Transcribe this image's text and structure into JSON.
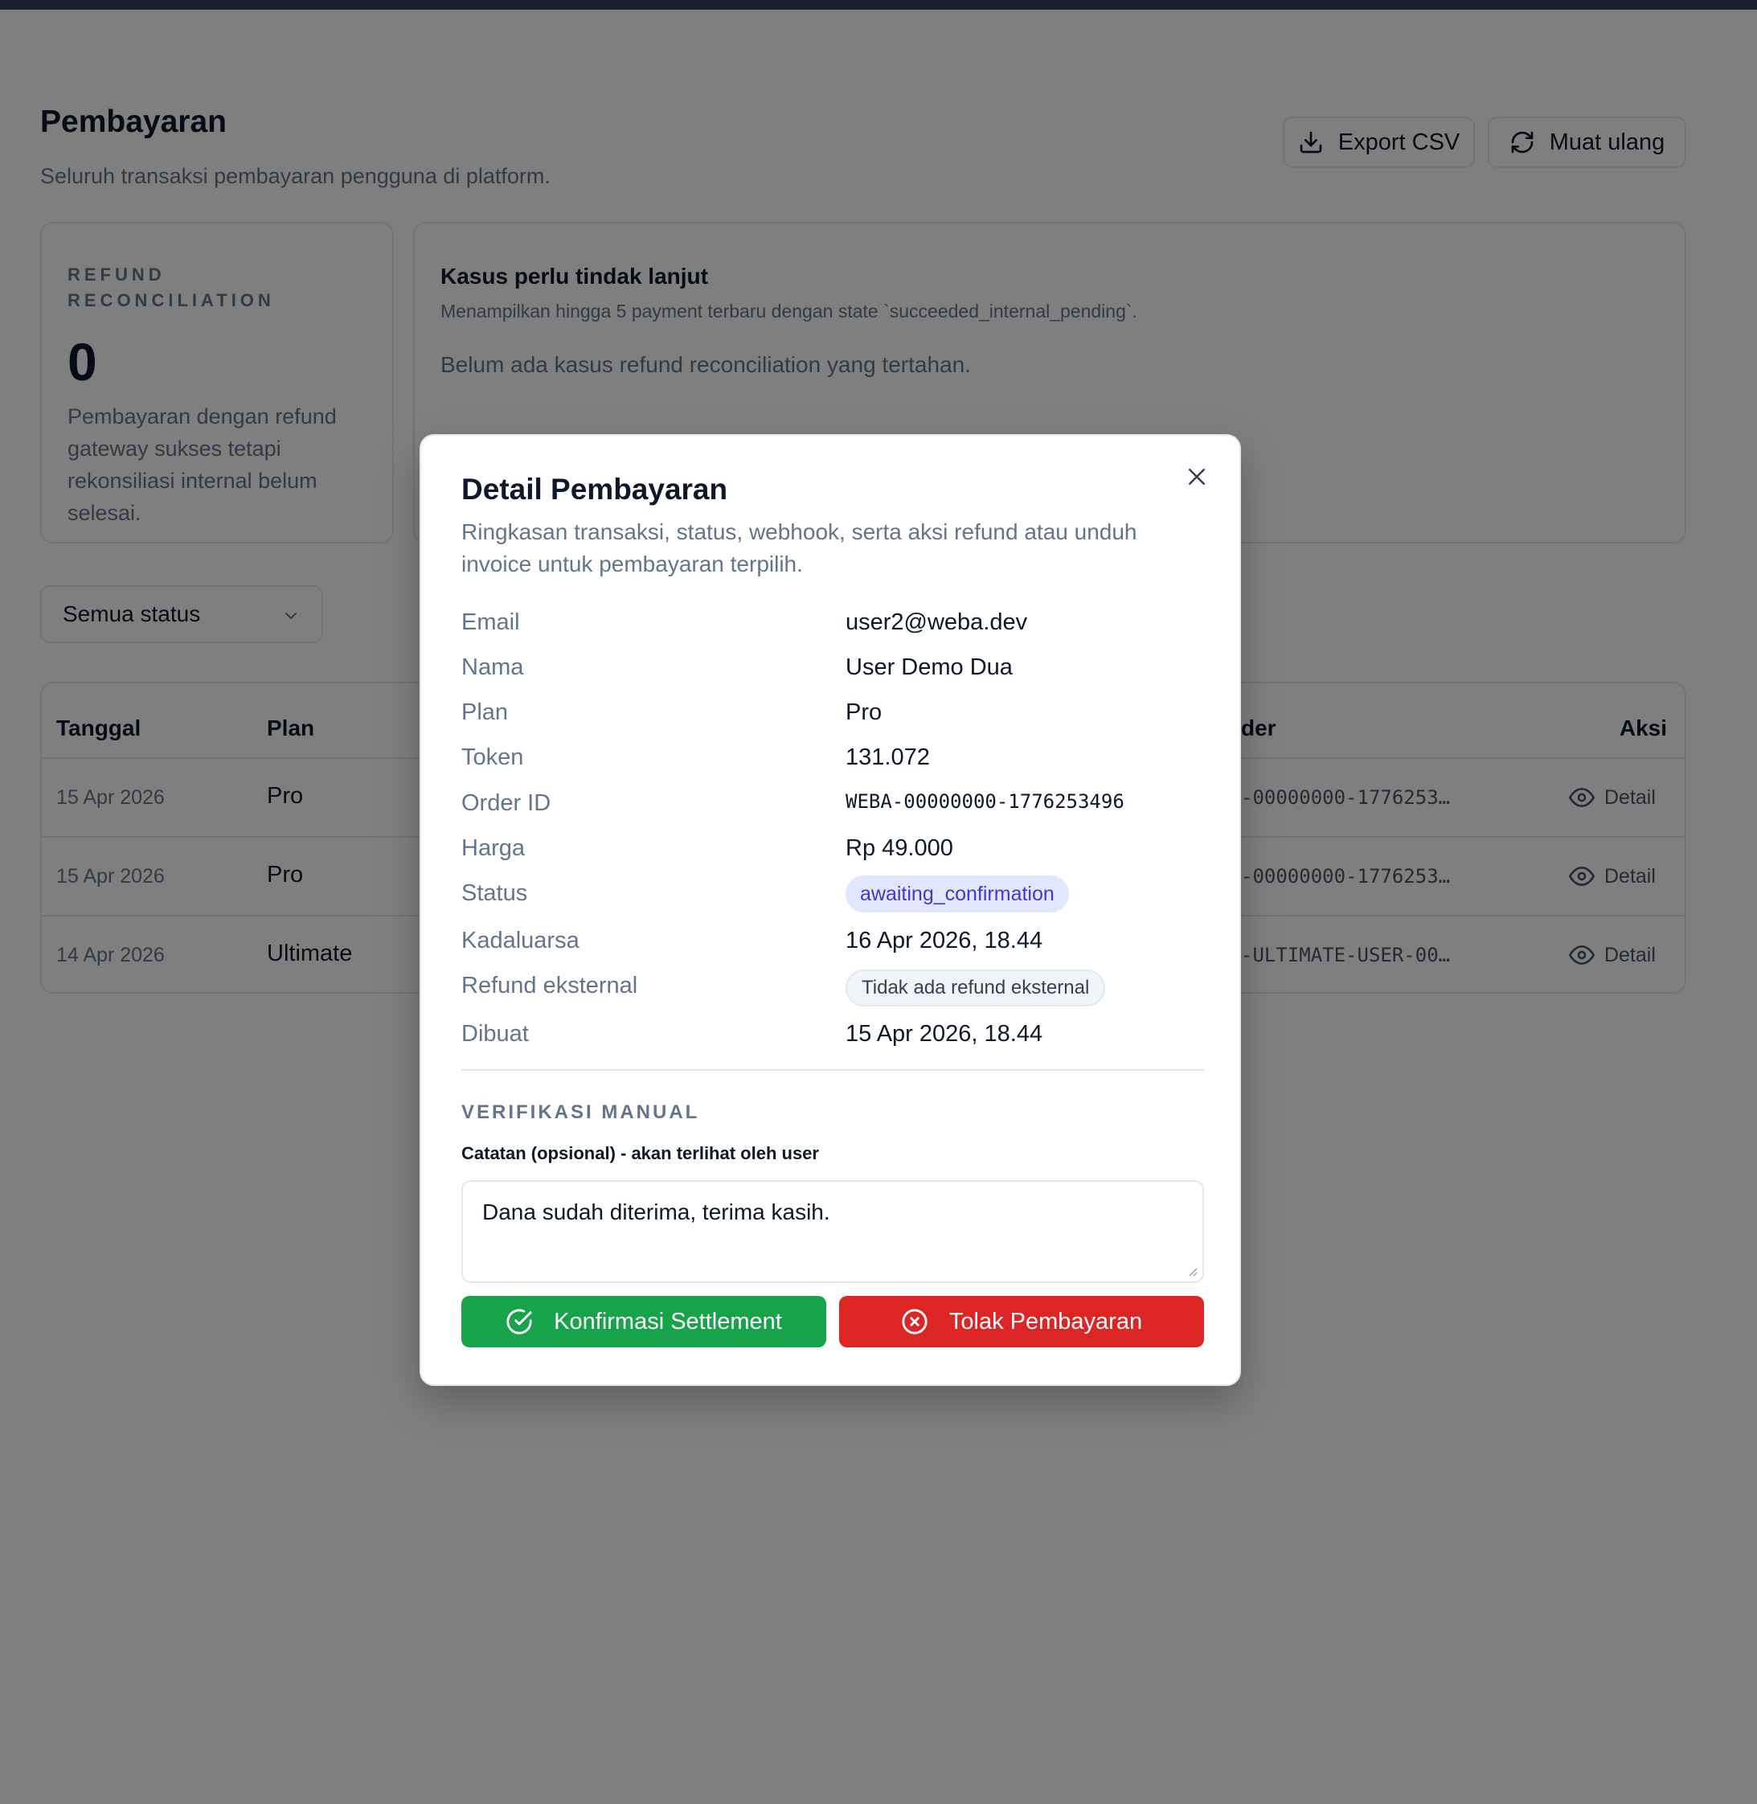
{
  "header": {
    "title": "Pembayaran",
    "subtitle": "Seluruh transaksi pembayaran pengguna di platform.",
    "export_label": "Export CSV",
    "reload_label": "Muat ulang"
  },
  "refund_card": {
    "eyebrow": "REFUND RECONCILIATION",
    "count": "0",
    "description": "Pembayaran dengan refund gateway sukses tetapi rekonsiliasi internal belum selesai."
  },
  "cases_card": {
    "title": "Kasus perlu tindak lanjut",
    "subtitle": "Menampilkan hingga 5 payment terbaru dengan state `succeeded_internal_pending`.",
    "empty": "Belum ada kasus refund reconciliation yang tertahan."
  },
  "filter": {
    "selected": "Semua status"
  },
  "table": {
    "columns": {
      "date": "Tanggal",
      "plan": "Plan",
      "order": "der",
      "action": "Aksi"
    },
    "rows": [
      {
        "date": "15 Apr 2026",
        "plan": "Pro",
        "order": "-00000000-1776253…",
        "action": "Detail"
      },
      {
        "date": "15 Apr 2026",
        "plan": "Pro",
        "order": "-00000000-1776253…",
        "action": "Detail"
      },
      {
        "date": "14 Apr 2026",
        "plan": "Ultimate",
        "order": "-ULTIMATE-USER-00…",
        "action": "Detail"
      }
    ]
  },
  "modal": {
    "title": "Detail Pembayaran",
    "subtitle": "Ringkasan transaksi, status, webhook, serta aksi refund atau unduh invoice untuk pembayaran terpilih.",
    "fields": {
      "email": {
        "label": "Email",
        "value": "user2@weba.dev"
      },
      "nama": {
        "label": "Nama",
        "value": "User Demo Dua"
      },
      "plan": {
        "label": "Plan",
        "value": "Pro"
      },
      "token": {
        "label": "Token",
        "value": "131.072"
      },
      "order_id": {
        "label": "Order ID",
        "value": "WEBA-00000000-1776253496"
      },
      "harga": {
        "label": "Harga",
        "value": "Rp 49.000"
      },
      "status": {
        "label": "Status",
        "value": "awaiting_confirmation"
      },
      "kadaluarsa": {
        "label": "Kadaluarsa",
        "value": "16 Apr 2026, 18.44"
      },
      "refund": {
        "label": "Refund eksternal",
        "value": "Tidak ada refund eksternal"
      },
      "dibuat": {
        "label": "Dibuat",
        "value": "15 Apr 2026, 18.44"
      }
    },
    "verification": {
      "section_title": "VERIFIKASI MANUAL",
      "note_label": "Catatan (opsional) - akan terlihat oleh user",
      "note_value": "Dana sudah diterima, terima kasih.",
      "confirm_label": "Konfirmasi Settlement",
      "reject_label": "Tolak Pembayaran"
    }
  },
  "icons": {
    "export": "download-icon",
    "reload": "refresh-icon",
    "select": "chevron-down-icon",
    "detail": "eye-icon",
    "close": "close-icon",
    "confirm": "check-circle-icon",
    "reject": "x-circle-icon"
  },
  "colors": {
    "topbar": "#334155",
    "confirm": "#16a34a",
    "reject": "#dc2626",
    "status_badge_bg": "#e0e7ff",
    "status_badge_text": "#4338ca"
  }
}
